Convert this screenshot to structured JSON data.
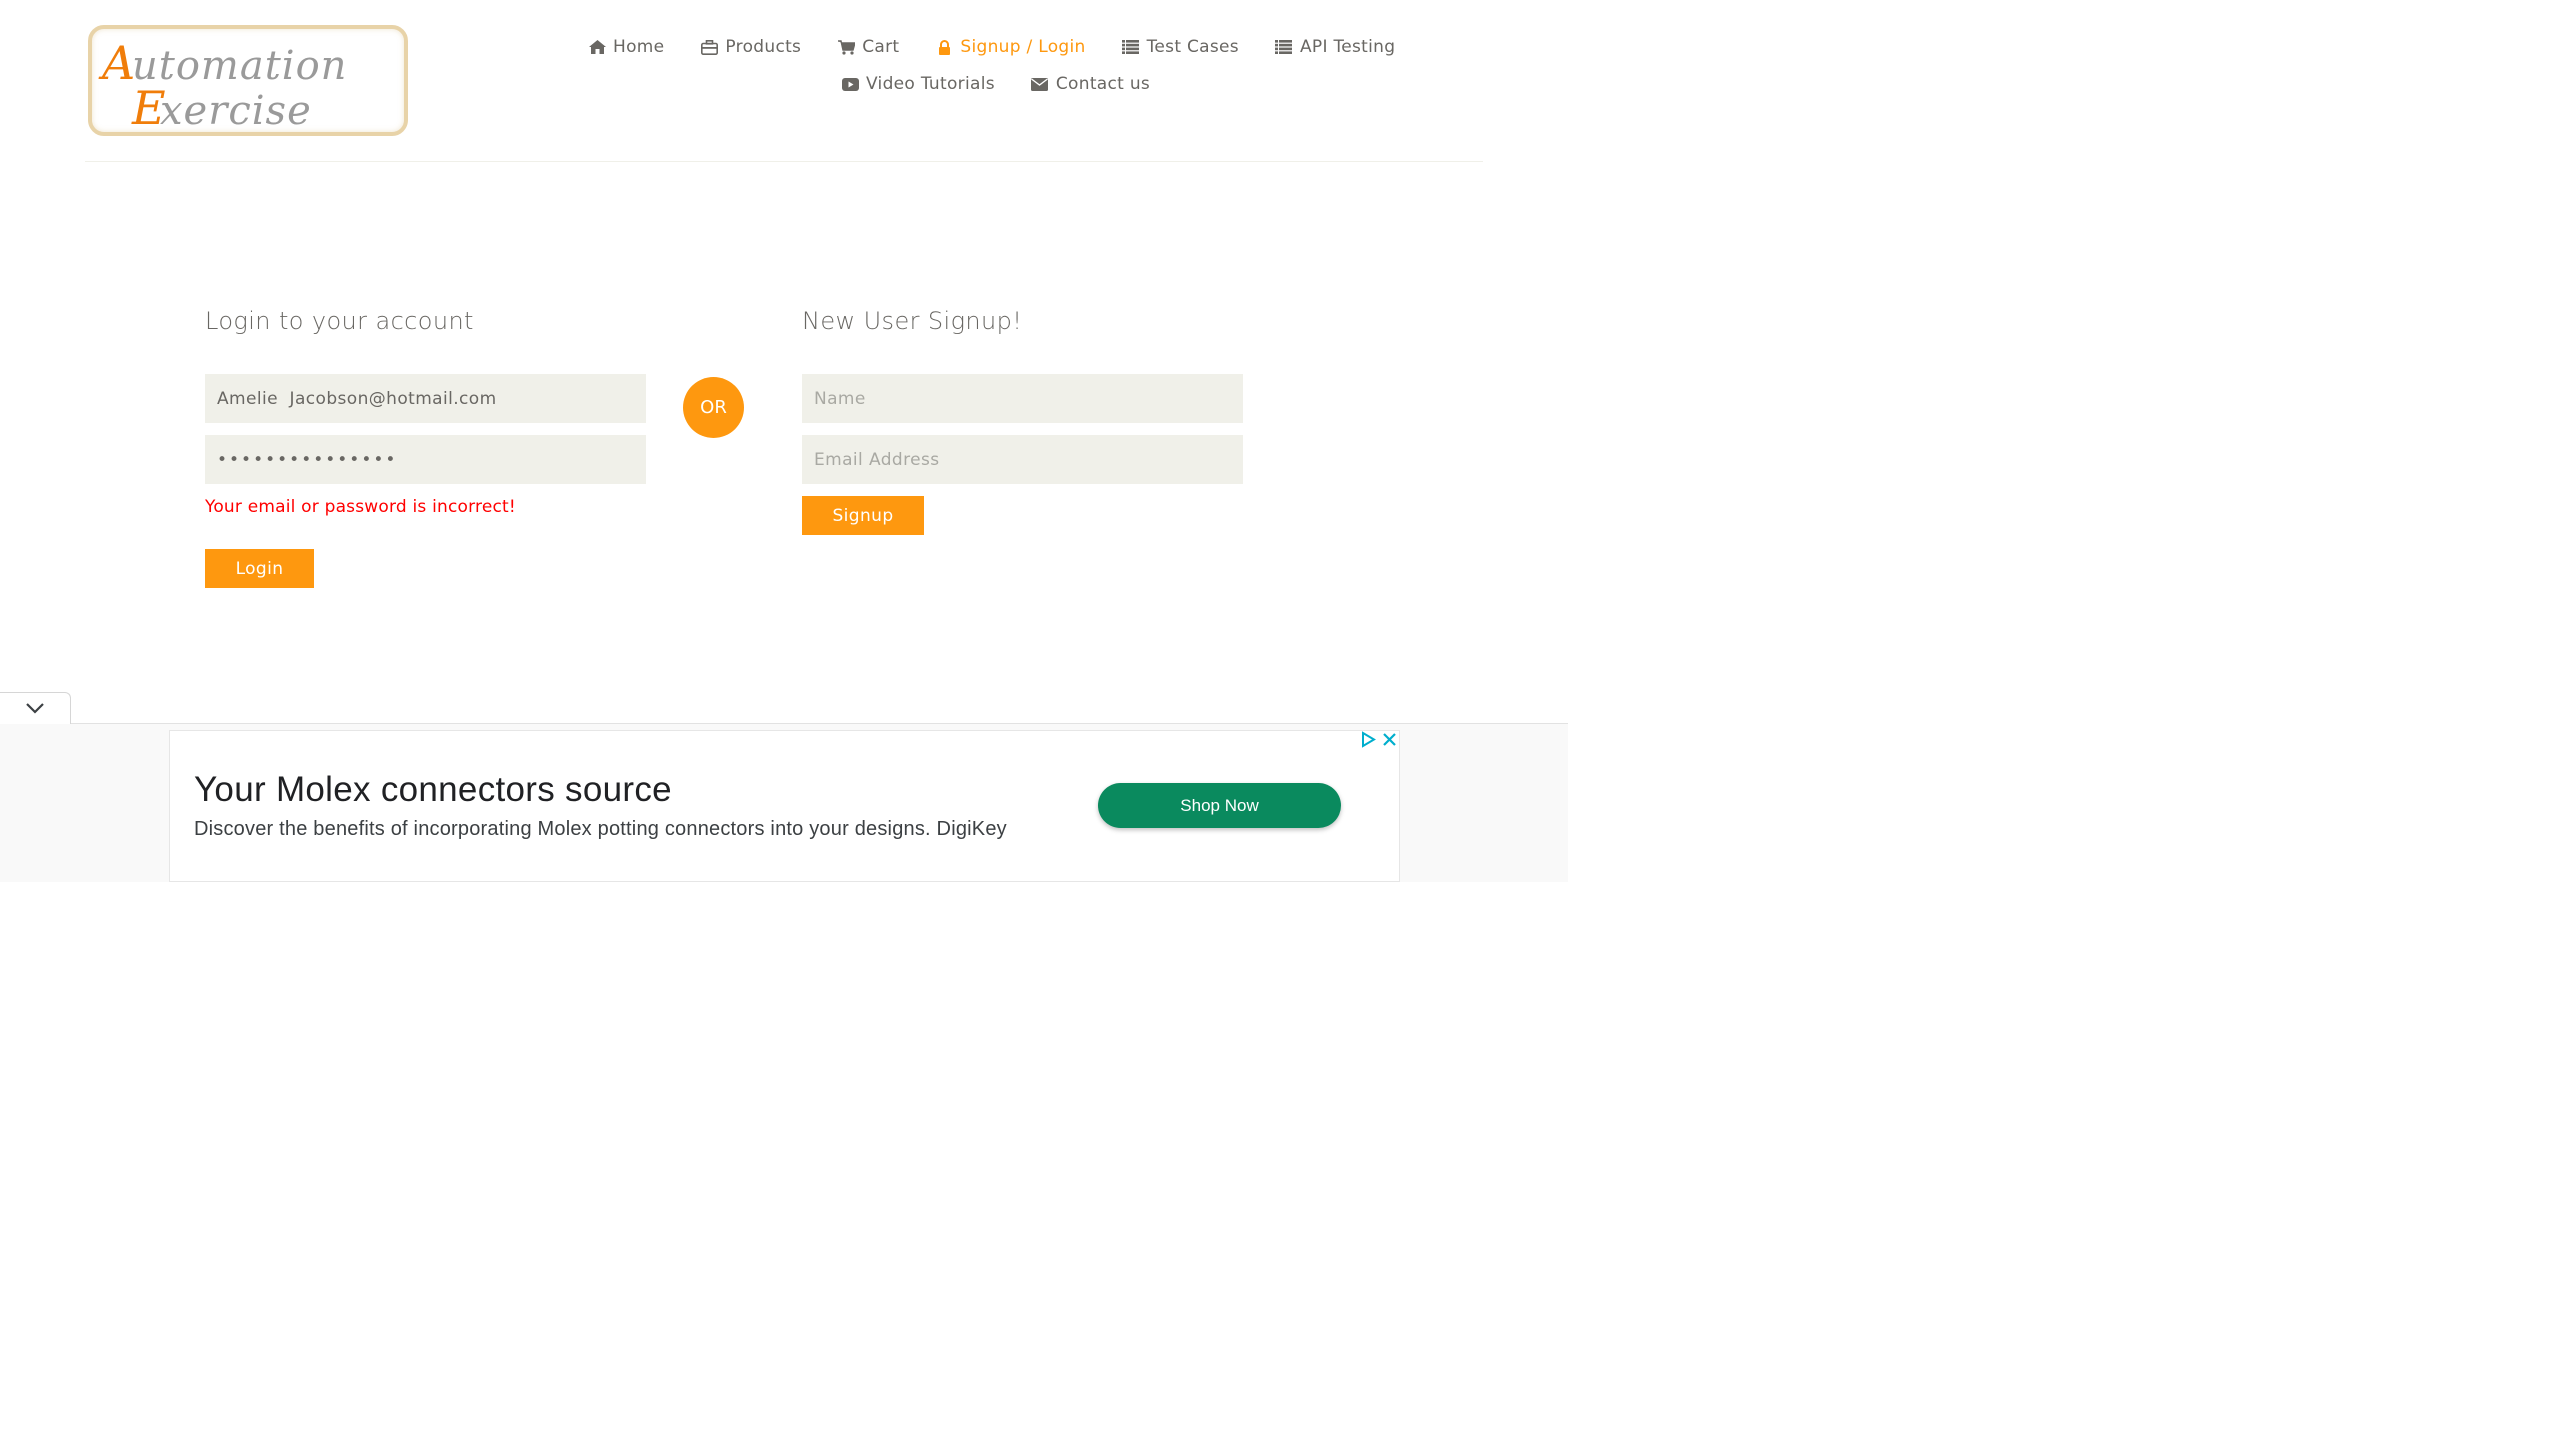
{
  "logo": {
    "line1": "Automation",
    "line2": "Exercise"
  },
  "nav": {
    "row1": [
      {
        "label": "Home",
        "icon": "home-icon"
      },
      {
        "label": "Products",
        "icon": "products-icon"
      },
      {
        "label": "Cart",
        "icon": "cart-icon"
      },
      {
        "label": "Signup / Login",
        "icon": "lock-icon",
        "active": true
      },
      {
        "label": "Test Cases",
        "icon": "list-icon"
      },
      {
        "label": "API Testing",
        "icon": "list-icon"
      }
    ],
    "row2": [
      {
        "label": "Video Tutorials",
        "icon": "youtube-icon"
      },
      {
        "label": "Contact us",
        "icon": "envelope-icon"
      }
    ]
  },
  "login": {
    "title": "Login to your account",
    "email_value": "Amelie  Jacobson@hotmail.com",
    "password_value": "•••••••••••••••",
    "error": "Your email or password is incorrect!",
    "button": "Login"
  },
  "or_label": "OR",
  "signup": {
    "title": "New User Signup!",
    "name_placeholder": "Name",
    "email_placeholder": "Email Address",
    "button": "Signup"
  },
  "ad": {
    "title": "Your Molex connectors source",
    "description": "Discover the benefits of incorporating Molex potting connectors into your designs. DigiKey",
    "cta": "Shop Now"
  },
  "colors": {
    "accent": "#fe980f",
    "error": "#ff0000",
    "field_bg": "#f0f0e9",
    "ad_cta": "#0a8a5e"
  }
}
